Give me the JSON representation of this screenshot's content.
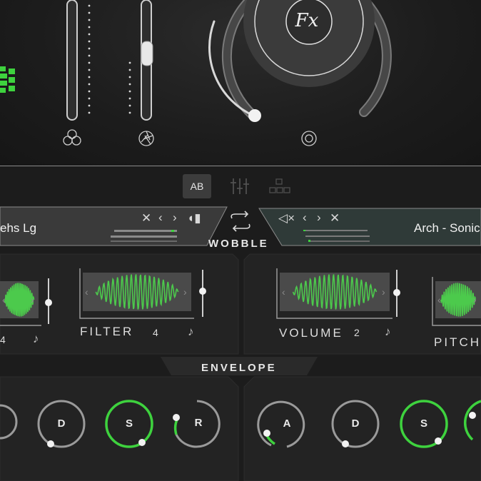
{
  "fx": {
    "label": "Fx"
  },
  "tabs": [
    {
      "name": "ab-tab",
      "label": "AB"
    },
    {
      "name": "mixer-tab",
      "label": ""
    },
    {
      "name": "grid-tab",
      "label": ""
    }
  ],
  "preset_left": {
    "name": "ehs Lg",
    "icons": [
      "close-icon",
      "chevron-left-icon",
      "chevron-right-icon",
      "speaker-icon"
    ]
  },
  "preset_right": {
    "name": "Arch - Sonic",
    "icons": [
      "mute-icon",
      "chevron-left-icon",
      "chevron-right-icon",
      "close-icon"
    ]
  },
  "wobble": {
    "title": "WOBBLE",
    "modules": [
      {
        "label": "",
        "num": "4",
        "note": "♪"
      },
      {
        "label": "FILTER",
        "num": "4",
        "note": "♪"
      },
      {
        "label": "VOLUME",
        "num": "2",
        "note": "♪"
      },
      {
        "label": "PITCH",
        "num": "",
        "note": ""
      }
    ]
  },
  "envelope": {
    "title": "ENVELOPE",
    "left_knobs": [
      "D",
      "S",
      "R"
    ],
    "right_knobs": [
      "A",
      "D",
      "S"
    ]
  },
  "colors": {
    "accent": "#4dd84d",
    "panel": "#232323",
    "line": "#8a8a8a"
  }
}
